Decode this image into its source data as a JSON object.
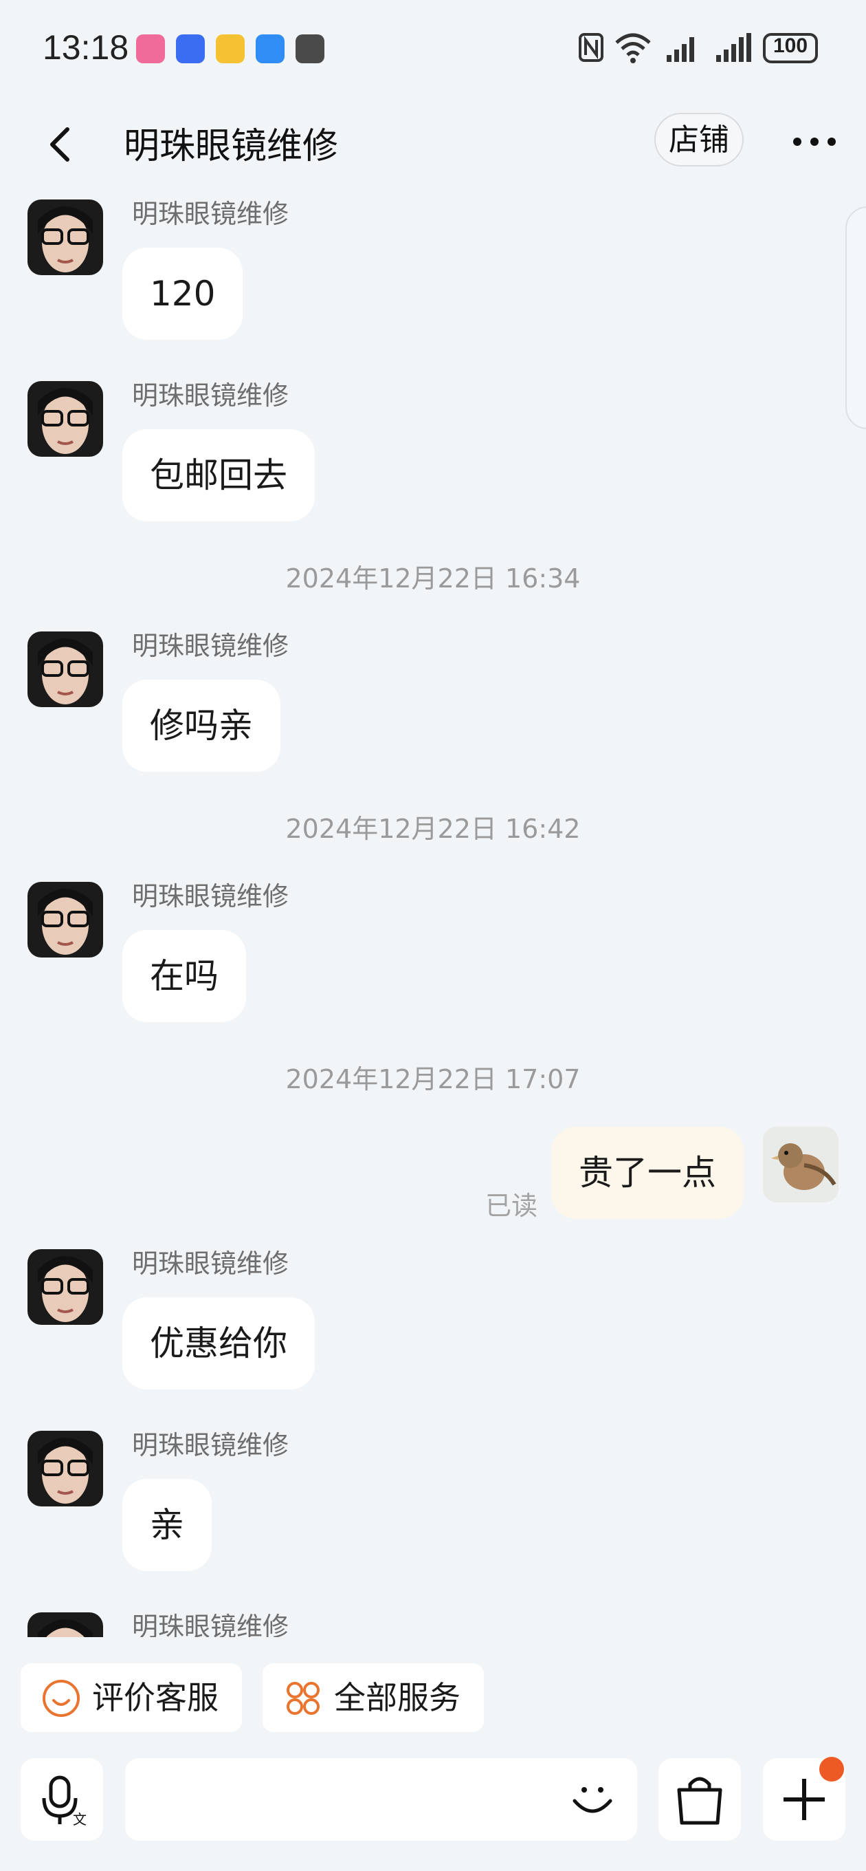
{
  "status_bar": {
    "time": "13:18",
    "battery": "100",
    "icons": [
      "bilibili-icon",
      "voice-recorder-icon",
      "mail-icon",
      "message-icon",
      "game-icon",
      "nfc-icon",
      "wifi-icon",
      "signal-1-icon",
      "signal-2-icon",
      "battery-icon"
    ]
  },
  "header": {
    "title": "明珠眼镜维修",
    "shop_label": "店铺"
  },
  "messages": [
    {
      "sender": "明珠眼镜维修",
      "text": "120"
    },
    {
      "sender": "明珠眼镜维修",
      "text": "包邮回去"
    },
    {
      "timestamp": "2024年12月22日 16:34"
    },
    {
      "sender": "明珠眼镜维修",
      "text": "修吗亲"
    },
    {
      "timestamp": "2024年12月22日 16:42"
    },
    {
      "sender": "明珠眼镜维修",
      "text": "在吗"
    },
    {
      "timestamp": "2024年12月22日 17:07"
    },
    {
      "self": true,
      "text": "贵了一点",
      "status": "已读"
    },
    {
      "sender": "明珠眼镜维修",
      "text": "优惠给你"
    },
    {
      "sender": "明珠眼镜维修",
      "text": "亲"
    },
    {
      "sender": "明珠眼镜维修",
      "text": ""
    }
  ],
  "quick_actions": {
    "rate": "评价客服",
    "all_services": "全部服务"
  },
  "input_bar": {
    "placeholder": ""
  },
  "colors": {
    "background": "#f1f5f8",
    "self_bubble": "#fdf6ea",
    "accent_orange": "#ee5a24"
  }
}
